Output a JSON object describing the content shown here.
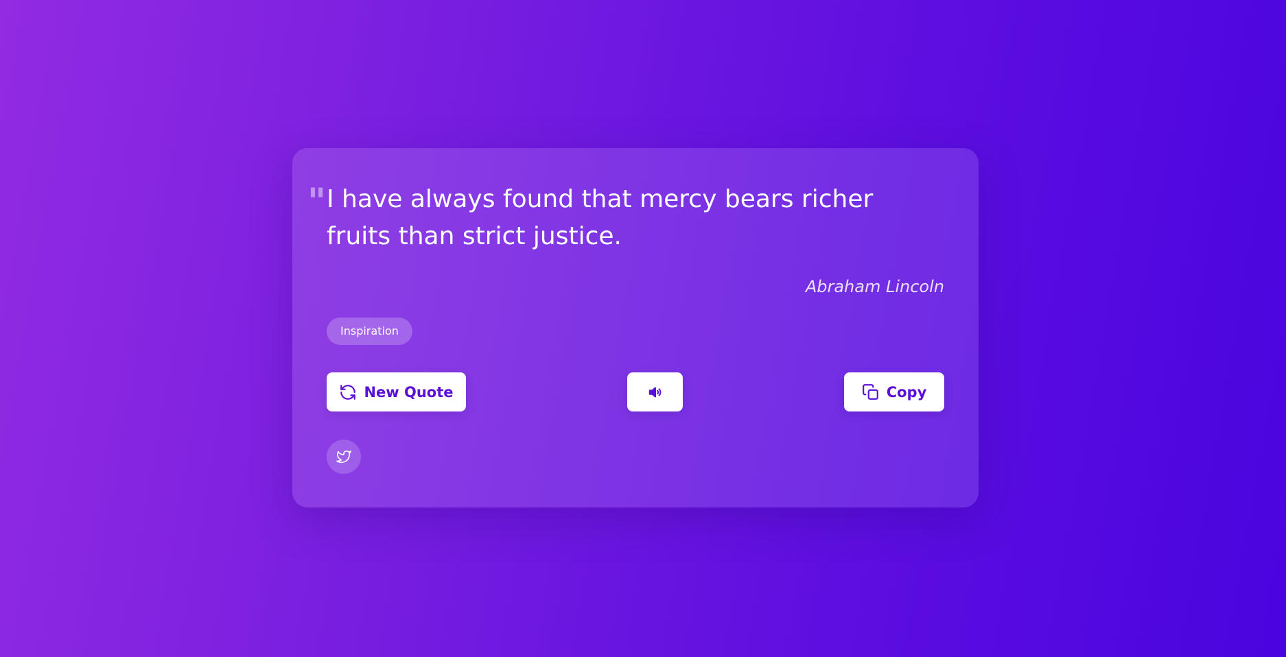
{
  "quote": {
    "mark": "\"",
    "text": "I have always found that mercy bears richer fruits than strict justice.",
    "author": "Abraham Lincoln",
    "tag": "Inspiration"
  },
  "actions": {
    "new_quote_label": "New Quote",
    "new_quote_icon": "refresh-icon",
    "speak_icon": "speaker-icon",
    "copy_label": "Copy",
    "copy_icon": "copy-icon",
    "share_icon": "twitter-icon"
  },
  "colors": {
    "background_start": "#922be2",
    "background_end": "#4a04df",
    "button_text": "#5a10d6",
    "button_bg": "#ffffff"
  }
}
